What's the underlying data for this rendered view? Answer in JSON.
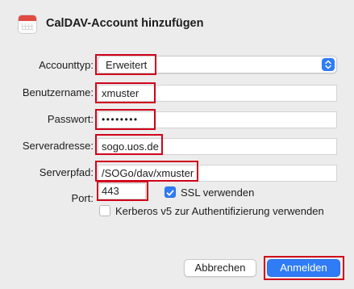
{
  "window": {
    "title": "CalDAV-Account hinzufügen",
    "icon": "calendar-icon"
  },
  "form": {
    "account_type": {
      "label": "Accounttyp:",
      "value": "Erweitert",
      "stepper_icon": "chevron-updown-icon"
    },
    "username": {
      "label": "Benutzername:",
      "value": "xmuster"
    },
    "password": {
      "label": "Passwort:",
      "value": "••••••••"
    },
    "server_address": {
      "label": "Serveradresse:",
      "value": "sogo.uos.de"
    },
    "server_path": {
      "label": "Serverpfad:",
      "value": "/SOGo/dav/xmuster"
    },
    "port": {
      "label": "Port:",
      "value": "443"
    },
    "ssl": {
      "label": "SSL verwenden",
      "checked": true
    },
    "kerberos": {
      "label": "Kerberos v5 zur Authentifizierung verwenden",
      "checked": false
    }
  },
  "buttons": {
    "cancel": "Abbrechen",
    "submit": "Anmelden"
  },
  "colors": {
    "accent": "#2f7cf6",
    "highlight": "#d0021b",
    "background": "#ececec"
  }
}
